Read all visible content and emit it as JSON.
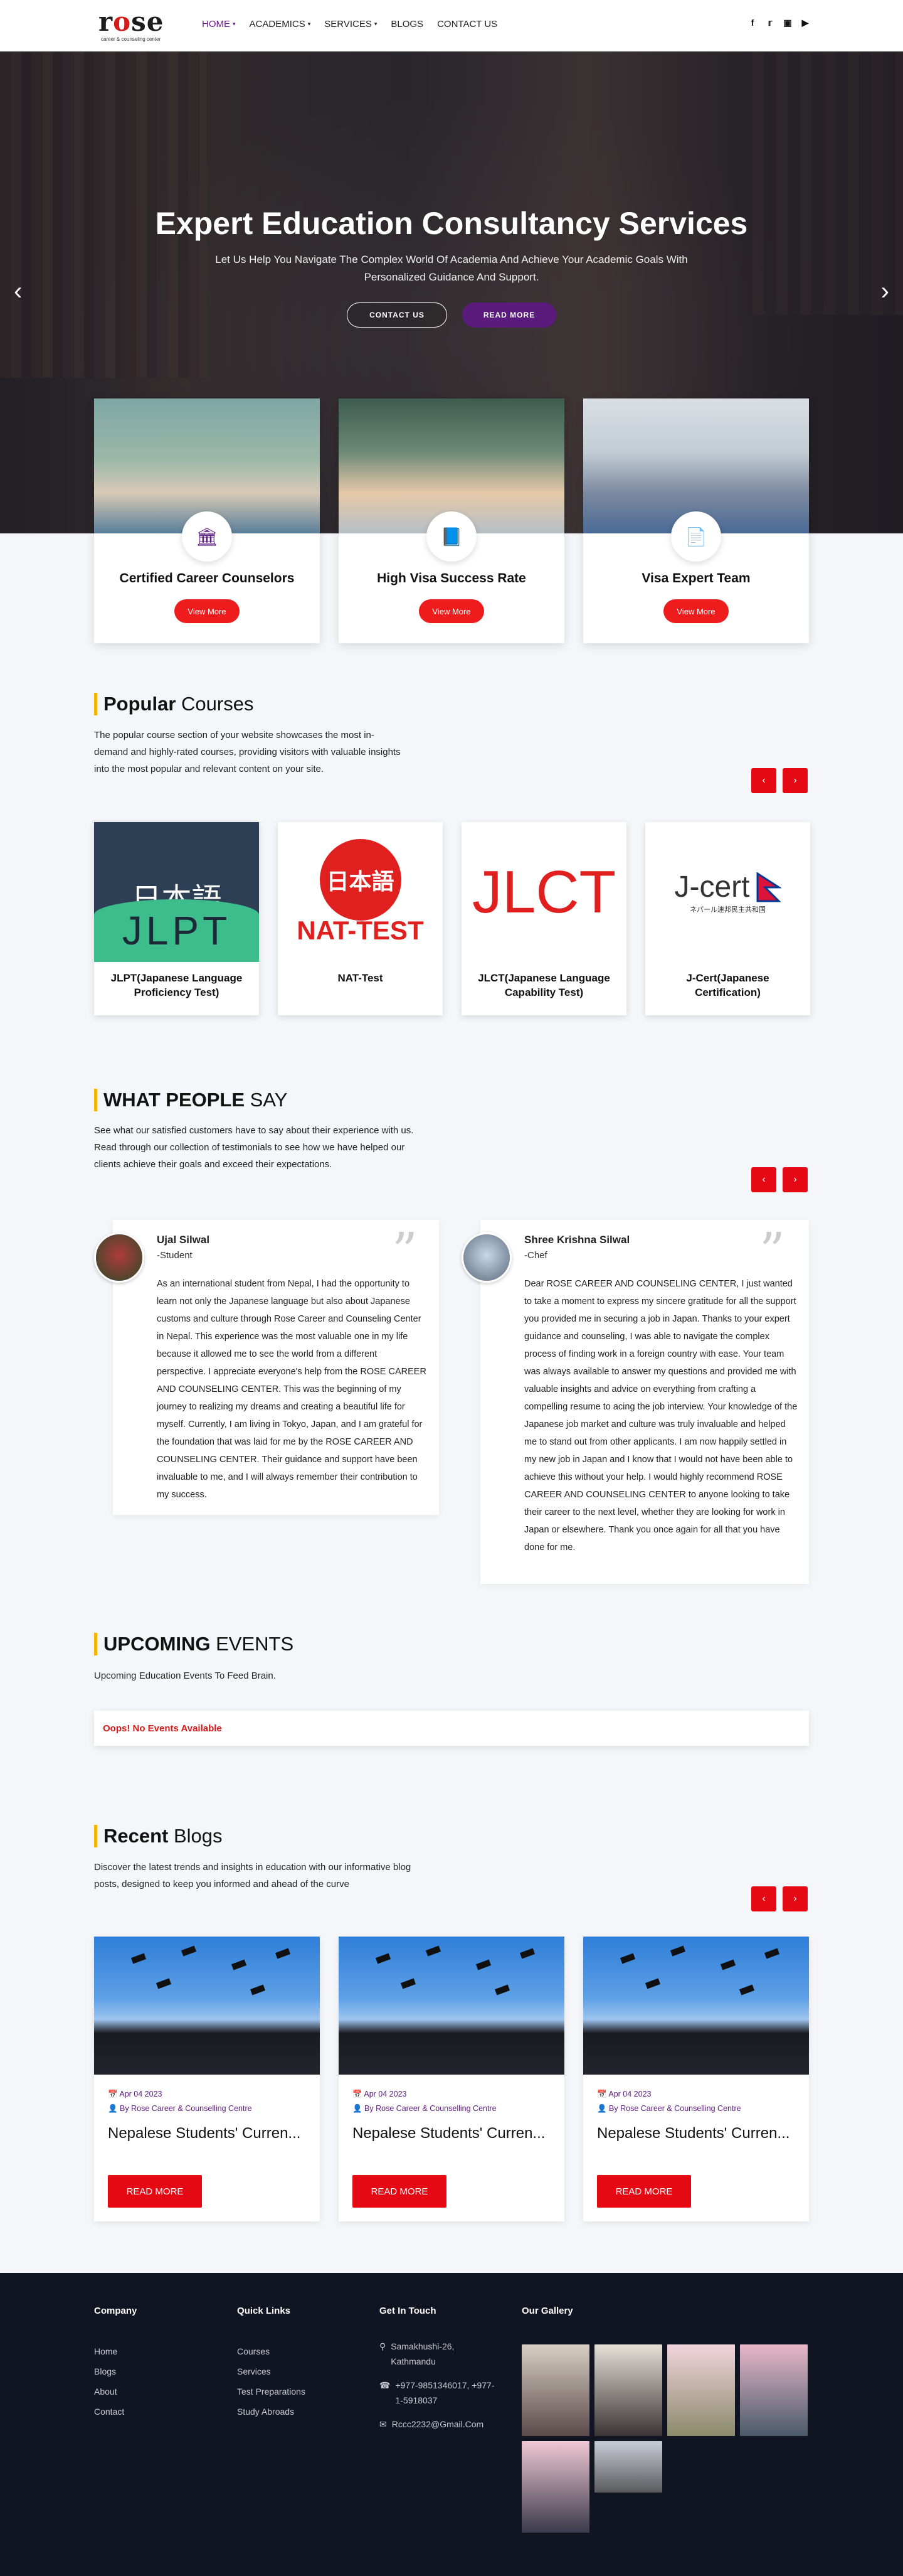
{
  "header": {
    "logo_main": "rose",
    "logo_sub": "career & counseling center",
    "nav": [
      {
        "label": "HOME",
        "has_caret": true,
        "active": true
      },
      {
        "label": "ACADEMICS",
        "has_caret": true
      },
      {
        "label": "SERVICES",
        "has_caret": true
      },
      {
        "label": "BLOGS",
        "has_caret": false
      },
      {
        "label": "CONTACT US",
        "has_caret": false
      }
    ],
    "social_icons": [
      "facebook-icon",
      "twitter-icon",
      "instagram-icon",
      "youtube-icon"
    ]
  },
  "hero": {
    "title": "Expert Education Consultancy Services",
    "subtitle": "Let Us Help You Navigate The Complex World Of Academia And Achieve Your Academic Goals With Personalized Guidance And Support.",
    "btn_contact": "CONTACT US",
    "btn_read": "READ MORE"
  },
  "features": [
    {
      "title": "Certified Career Counselors",
      "button": "View More",
      "icon": "institution-icon"
    },
    {
      "title": "High Visa Success Rate",
      "button": "View More",
      "icon": "book-icon"
    },
    {
      "title": "Visa Expert Team",
      "button": "View More",
      "icon": "document-icon"
    }
  ],
  "courses_section": {
    "title_bold": "Popular",
    "title_rest": " Courses",
    "description": "The popular course section of your website showcases the most in-demand and highly-rated courses, providing visitors with valuable insights into the most popular and relevant content on your site.",
    "courses": [
      {
        "name": "JLPT(Japanese Language Proficiency Test)",
        "logo_top": "日本語",
        "logo_bottom": "JLPT"
      },
      {
        "name": "NAT-Test",
        "logo_top": "日本語",
        "logo_bottom": "NAT-TEST"
      },
      {
        "name": "JLCT(Japanese Language Capability Test)",
        "logo_top": "JLCT",
        "logo_bottom": ""
      },
      {
        "name": "J-Cert(Japanese Certification)",
        "logo_top": "J-cert",
        "logo_bottom": "ネパール連邦民主共和国"
      }
    ]
  },
  "testimonials_section": {
    "title_bold": "WHAT PEOPLE",
    "title_rest": " SAY",
    "description": "See what our satisfied customers have to say about their experience with us. Read through our collection of testimonials to see how we have helped our clients achieve their goals and exceed their expectations.",
    "items": [
      {
        "name": "Ujal Silwal",
        "role": "-Student",
        "text": "As an international student from Nepal, I had the opportunity to learn not only the Japanese language but also about Japanese customs and culture through Rose Career and Counseling Center in Nepal. This experience was the most valuable one in my life because it allowed me to see the world from a different perspective. I appreciate everyone's help from the ROSE CAREER AND COUNSELING CENTER. This was the beginning of my journey to realizing my dreams and creating a beautiful life for myself. Currently, I am living in Tokyo, Japan, and I am grateful for the foundation that was laid for me by the ROSE CAREER AND COUNSELING CENTER. Their guidance and support have been invaluable to me, and I will always remember their contribution to my success."
      },
      {
        "name": "Shree Krishna Silwal",
        "role": "-Chef",
        "text": "Dear ROSE CAREER AND COUNSELING CENTER, I just wanted to take a moment to express my sincere gratitude for all the support you provided me in securing a job in Japan. Thanks to your expert guidance and counseling, I was able to navigate the complex process of finding work in a foreign country with ease. Your team was always available to answer my questions and provided me with valuable insights and advice on everything from crafting a compelling resume to acing the job interview. Your knowledge of the Japanese job market and culture was truly invaluable and helped me to stand out from other applicants. I am now happily settled in my new job in Japan and I know that I would not have been able to achieve this without your help. I would highly recommend ROSE CAREER AND COUNSELING CENTER to anyone looking to take their career to the next level, whether they are looking for work in Japan or elsewhere. Thank you once again for all that you have done for me."
      }
    ]
  },
  "events_section": {
    "title_bold": "UPCOMING",
    "title_rest": " EVENTS",
    "description": "Upcoming Education Events To Feed Brain.",
    "empty_message": "Oops! No Events Available"
  },
  "blogs_section": {
    "title_bold": "Recent",
    "title_rest": " Blogs",
    "description": "Discover the latest trends and insights in education with our informative blog posts, designed to keep you informed and ahead of the curve",
    "posts": [
      {
        "date": "Apr 04 2023",
        "author": "By Rose Career & Counselling Centre",
        "title": "Nepalese Students' Curren...",
        "button": "READ MORE"
      },
      {
        "date": "Apr 04 2023",
        "author": "By Rose Career & Counselling Centre",
        "title": "Nepalese Students' Curren...",
        "button": "READ MORE"
      },
      {
        "date": "Apr 04 2023",
        "author": "By Rose Career & Counselling Centre",
        "title": "Nepalese Students' Curren...",
        "button": "READ MORE"
      }
    ]
  },
  "footer": {
    "company": {
      "title": "Company",
      "links": [
        "Home",
        "Blogs",
        "About",
        "Contact"
      ]
    },
    "quick_links": {
      "title": "Quick Links",
      "links": [
        "Courses",
        "Services",
        "Test Preparations",
        "Study Abroads"
      ]
    },
    "contact": {
      "title": "Get In Touch",
      "address": "Samakhushi-26, Kathmandu",
      "phone": "+977-9851346017, +977-1-5918037",
      "email": "Rccc2232@Gmail.Com"
    },
    "gallery": {
      "title": "Our Gallery"
    }
  },
  "colors": {
    "accent_red": "#e50914",
    "brand_purple": "#5a1b7c",
    "heading_bar": "#f6b300",
    "footer_bg": "#111522"
  }
}
